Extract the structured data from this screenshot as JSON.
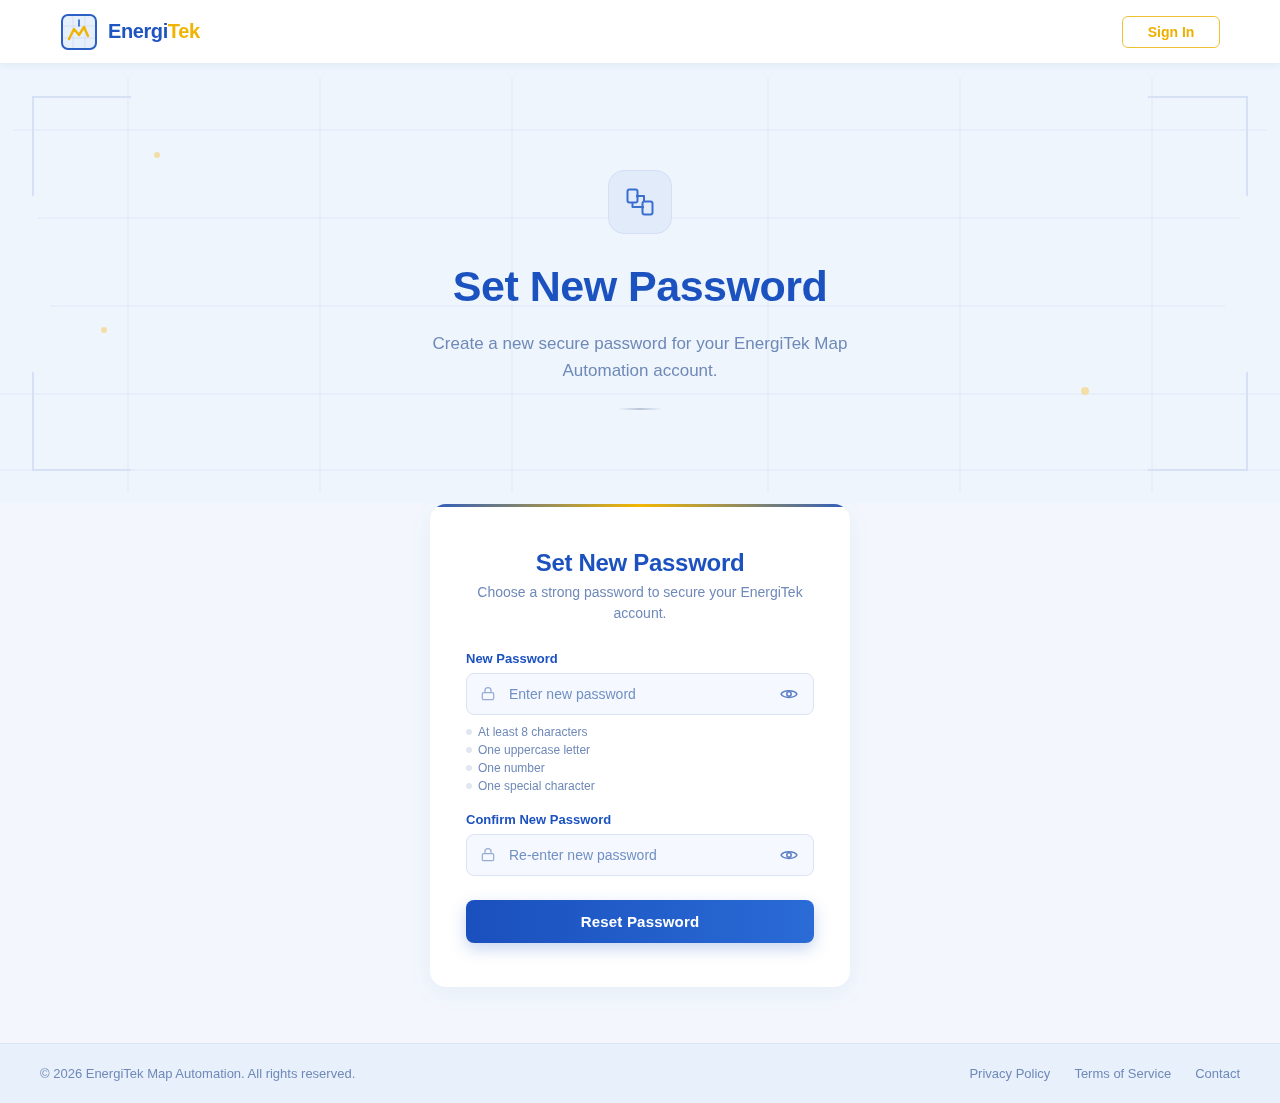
{
  "header": {
    "brand": {
      "name_start": "Energi",
      "name_end": "Tek"
    },
    "sign_in_button": "Sign In"
  },
  "hero": {
    "title": "Set New Password",
    "subtitle": "Create a new secure password for your EnergiTek Map Automation account."
  },
  "card": {
    "title": "Set New Password",
    "subtitle": "Choose a strong password to secure your EnergiTek account.",
    "fields": [
      {
        "label": "New Password",
        "placeholder": "Enter new password",
        "requirements": [
          {
            "text": "At least 8 characters",
            "met": false
          },
          {
            "text": "One uppercase letter",
            "met": false
          },
          {
            "text": "One number",
            "met": false
          },
          {
            "text": "One special character",
            "met": false
          }
        ]
      },
      {
        "label": "Confirm New Password",
        "placeholder": "Re-enter new password"
      }
    ],
    "submit_button": "Reset Password"
  },
  "footer": {
    "copyright": "© 2026 EnergiTek Map Automation. All rights reserved.",
    "links": [
      "Privacy Policy",
      "Terms of Service",
      "Contact"
    ]
  }
}
